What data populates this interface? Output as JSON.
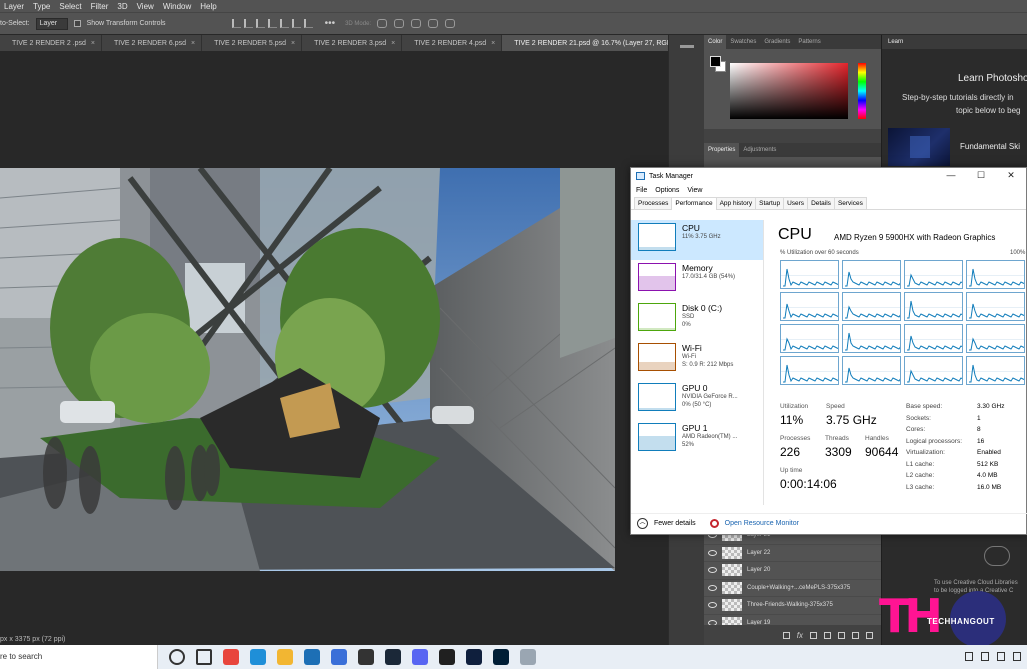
{
  "photoshop": {
    "menu": [
      "Layer",
      "Type",
      "Select",
      "Filter",
      "3D",
      "View",
      "Window",
      "Help"
    ],
    "options": {
      "auto_select_label": "to-Select:",
      "auto_select_value": "Layer",
      "transform_label": "Show Transform Controls",
      "mode_3d_label": "3D Mode:"
    },
    "doc_tabs": [
      {
        "label": "TIVE 2 RENDER 2 .psd",
        "active": false
      },
      {
        "label": "TIVE 2 RENDER 6.psd",
        "active": false
      },
      {
        "label": "TIVE 2 RENDER 5.psd",
        "active": false
      },
      {
        "label": "TIVE 2 RENDER 3.psd",
        "active": false
      },
      {
        "label": "TIVE 2 RENDER 4.psd",
        "active": false
      },
      {
        "label": "TIVE 2 RENDER 21.psd @ 16.7% (Layer 27, RGB/8)",
        "active": true
      }
    ],
    "tabs_overflow": "»",
    "status_text": "px x 3375 px (72 ppi)",
    "color_tabs": [
      "Color",
      "Swatches",
      "Gradients",
      "Patterns"
    ],
    "properties_tabs": [
      "Properties",
      "Adjustments"
    ],
    "layers": [
      "Layer 21",
      "Layer 22",
      "Layer 20",
      "Couple+Walking+...ceMePLS-375x375",
      "Three-Friends-Walking-375x375",
      "Layer 19"
    ],
    "fx_label": "fx",
    "learn": {
      "tab": "Learn",
      "title": "Learn Photosho",
      "subtitle_1": "Step-by-step tutorials directly in",
      "subtitle_2": "topic below to beg",
      "card_label": "Fundamental Ski",
      "cc_line_1": "To use Creative Cloud Libraries",
      "cc_line_2": "to be logged into a Creative C"
    }
  },
  "watermark": {
    "logo": "TH",
    "text": "TECHHANGOUT"
  },
  "task_manager": {
    "title": "Task Manager",
    "window_controls": [
      "—",
      "☐",
      "✕"
    ],
    "menu": [
      "File",
      "Options",
      "View"
    ],
    "tabs": [
      {
        "label": "Processes",
        "active": false
      },
      {
        "label": "Performance",
        "active": true
      },
      {
        "label": "App history",
        "active": false
      },
      {
        "label": "Startup",
        "active": false
      },
      {
        "label": "Users",
        "active": false
      },
      {
        "label": "Details",
        "active": false
      },
      {
        "label": "Services",
        "active": false
      }
    ],
    "resources": [
      {
        "name": "CPU",
        "line1": "11% 3.75 GHz",
        "line2": "",
        "color": "#117dbb",
        "level": 0.11
      },
      {
        "name": "Memory",
        "line1": "17.0/31.4 GB (54%)",
        "line2": "",
        "color": "#8b12ae",
        "level": 0.54
      },
      {
        "name": "Disk 0 (C:)",
        "line1": "SSD",
        "line2": "0%",
        "color": "#4da60c",
        "level": 0.0
      },
      {
        "name": "Wi-Fi",
        "line1": "Wi-Fi",
        "line2": "S: 0.9 R: 212 Mbps",
        "color": "#a74f01",
        "level": 0.3
      },
      {
        "name": "GPU 0",
        "line1": "NVIDIA GeForce R...",
        "line2": "0% (50 °C)",
        "color": "#117dbb",
        "level": 0.0
      },
      {
        "name": "GPU 1",
        "line1": "AMD Radeon(TM) ...",
        "line2": "52%",
        "color": "#117dbb",
        "level": 0.52
      }
    ],
    "cpu": {
      "heading": "CPU",
      "model": "AMD Ryzen 9 5900HX with Radeon Graphics",
      "graph_label": "% Utilization over 60 seconds",
      "graph_max": "100%",
      "utilization_label": "Utilization",
      "utilization": "11%",
      "speed_label": "Speed",
      "speed": "3.75 GHz",
      "processes_label": "Processes",
      "processes": "226",
      "threads_label": "Threads",
      "threads": "3309",
      "handles_label": "Handles",
      "handles": "90644",
      "uptime_label": "Up time",
      "uptime": "0:00:14:06",
      "details": [
        {
          "k": "Base speed:",
          "v": "3.30 GHz"
        },
        {
          "k": "Sockets:",
          "v": "1"
        },
        {
          "k": "Cores:",
          "v": "8"
        },
        {
          "k": "Logical processors:",
          "v": "16"
        },
        {
          "k": "Virtualization:",
          "v": "Enabled"
        },
        {
          "k": "L1 cache:",
          "v": "512 KB"
        },
        {
          "k": "L2 cache:",
          "v": "4.0 MB"
        },
        {
          "k": "L3 cache:",
          "v": "16.0 MB"
        }
      ]
    },
    "fewer_details": "Fewer details",
    "open_resource_monitor": "Open Resource Monitor"
  },
  "taskbar": {
    "search_text": "re to search",
    "apps": [
      {
        "name": "search-circle-icon",
        "color": "#333333"
      },
      {
        "name": "task-view-icon",
        "color": "#333333"
      },
      {
        "name": "chrome-icon",
        "color": "#e8453c"
      },
      {
        "name": "edge-icon",
        "color": "#1f8fd8"
      },
      {
        "name": "file-explorer-icon",
        "color": "#f2b632"
      },
      {
        "name": "mail-icon",
        "color": "#1d6fb5"
      },
      {
        "name": "autodesk-icon",
        "color": "#3a6fd8"
      },
      {
        "name": "xbox-icon",
        "color": "#333333"
      },
      {
        "name": "steam-icon",
        "color": "#1b2838"
      },
      {
        "name": "discord-icon",
        "color": "#5865f2"
      },
      {
        "name": "next-app-icon",
        "color": "#202020"
      },
      {
        "name": "photoshop-icon",
        "color": "#0f1f3d"
      },
      {
        "name": "photoshop-active-icon",
        "color": "#001e36"
      },
      {
        "name": "scanner-icon",
        "color": "#9aa6b2"
      }
    ]
  }
}
